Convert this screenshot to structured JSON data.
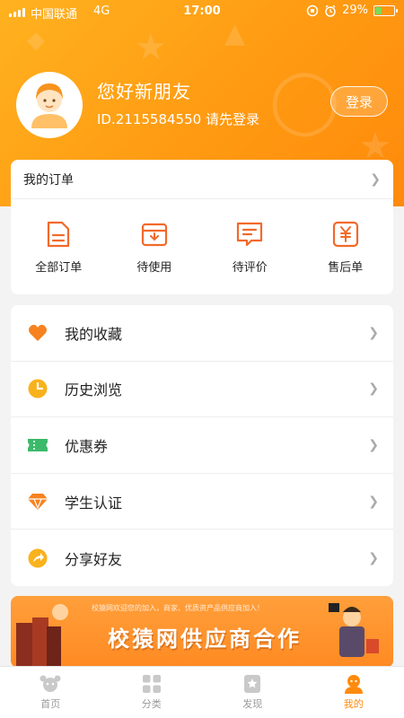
{
  "status_bar": {
    "carrier": "中国联通",
    "network": "4G",
    "time": "17:00",
    "battery": "29%"
  },
  "profile": {
    "greeting": "您好新朋友",
    "user_id_text": "ID.2115584550 请先登录",
    "login_label": "登录"
  },
  "orders": {
    "title": "我的订单",
    "items": [
      {
        "label": "全部订单",
        "icon": "all-orders-icon"
      },
      {
        "label": "待使用",
        "icon": "to-use-icon"
      },
      {
        "label": "待评价",
        "icon": "to-review-icon"
      },
      {
        "label": "售后单",
        "icon": "after-sales-icon"
      }
    ]
  },
  "menu": {
    "items": [
      {
        "label": "我的收藏",
        "icon": "heart-icon"
      },
      {
        "label": "历史浏览",
        "icon": "clock-icon"
      },
      {
        "label": "优惠券",
        "icon": "coupon-icon"
      },
      {
        "label": "学生认证",
        "icon": "diamond-icon"
      },
      {
        "label": "分享好友",
        "icon": "share-icon"
      }
    ]
  },
  "banner": {
    "small_text": "校猿网欢迎您的加入，商家、优质资产品供应商加入！",
    "big_text": "校猿网供应商合作"
  },
  "tabbar": {
    "items": [
      {
        "label": "首页",
        "icon": "home-icon"
      },
      {
        "label": "分类",
        "icon": "category-icon"
      },
      {
        "label": "发现",
        "icon": "discover-icon"
      },
      {
        "label": "我的",
        "icon": "profile-icon"
      }
    ],
    "active_index": 3
  },
  "colors": {
    "accent": "#ff8a0c",
    "header_start": "#ffb21f",
    "battery_fill": "#7ed957"
  }
}
